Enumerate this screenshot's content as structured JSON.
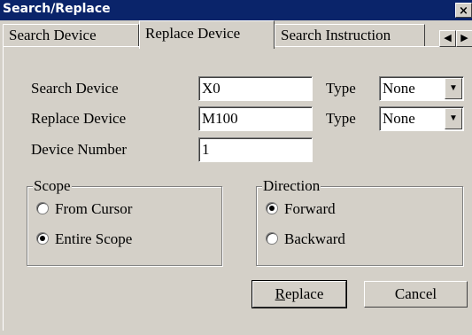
{
  "window": {
    "title": "Search/Replace",
    "close_label": "×"
  },
  "tabs": [
    {
      "label": "Search Device"
    },
    {
      "label": "Replace Device"
    },
    {
      "label": "Search Instruction"
    }
  ],
  "tab_scroll": {
    "left_icon": "arrow-left-icon",
    "right_icon": "arrow-right-icon",
    "left_glyph": "◀",
    "right_glyph": "▶"
  },
  "form": {
    "search_device": {
      "label": "Search Device",
      "value": "X0",
      "type_label": "Type",
      "type_value": "None"
    },
    "replace_device": {
      "label": "Replace Device",
      "value": "M100",
      "type_label": "Type",
      "type_value": "None"
    },
    "device_number": {
      "label": "Device Number",
      "value": "1"
    }
  },
  "combo_arrow_glyph": "▼",
  "scope": {
    "title": "Scope",
    "options": [
      {
        "label": "From Cursor",
        "selected": false
      },
      {
        "label": "Entire Scope",
        "selected": true
      }
    ]
  },
  "direction": {
    "title": "Direction",
    "options": [
      {
        "label": "Forward",
        "selected": true
      },
      {
        "label": "Backward",
        "selected": false
      }
    ]
  },
  "buttons": {
    "replace": {
      "label_first": "R",
      "label_rest": "eplace"
    },
    "cancel": "Cancel"
  }
}
